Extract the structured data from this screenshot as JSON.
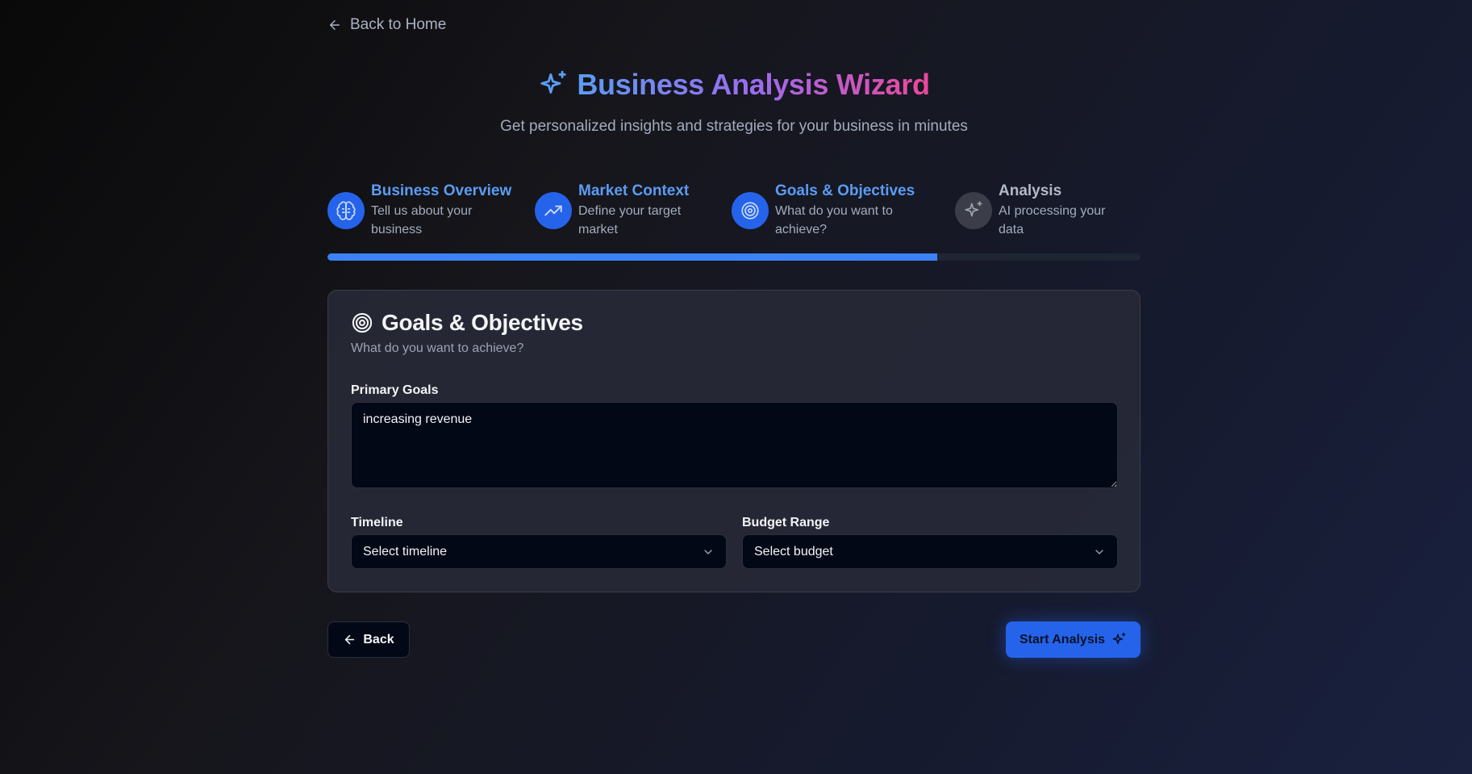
{
  "nav": {
    "back_home_label": "Back to Home"
  },
  "header": {
    "title": "Business Analysis Wizard",
    "subtitle": "Get personalized insights and strategies for your business in minutes"
  },
  "steps": [
    {
      "name": "Business Overview",
      "desc_line1": "Tell us about your",
      "desc_line2": "business",
      "icon": "brain-icon",
      "active": true
    },
    {
      "name": "Market Context",
      "desc_line1": "Define your target",
      "desc_line2": "market",
      "icon": "trending-up-icon",
      "active": true
    },
    {
      "name": "Goals & Objectives",
      "desc_line1": "What do you want to",
      "desc_line2": "achieve?",
      "icon": "target-icon",
      "active": true
    },
    {
      "name": "Analysis",
      "desc_line1": "AI processing your",
      "desc_line2": "data",
      "icon": "sparkles-icon",
      "active": false
    }
  ],
  "progress": {
    "percent": 75
  },
  "card": {
    "title": "Goals & Objectives",
    "subtitle": "What do you want to achieve?",
    "primary_goals_label": "Primary Goals",
    "primary_goals_value": "increasing revenue",
    "timeline_label": "Timeline",
    "timeline_value": "Select timeline",
    "budget_label": "Budget Range",
    "budget_value": "Select budget"
  },
  "actions": {
    "back_label": "Back",
    "start_label": "Start Analysis"
  },
  "colors": {
    "accent": "#2563eb",
    "progress_fill": "#3b82f6",
    "step_active_text": "#5b9cf2",
    "title_gradient": [
      "#5b9cf2",
      "#9b6cf0",
      "#ec4899"
    ]
  }
}
